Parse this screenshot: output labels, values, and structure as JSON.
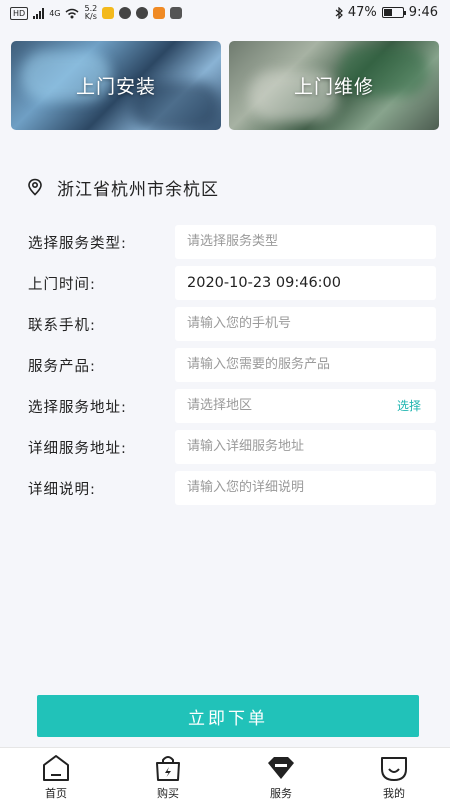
{
  "status_bar": {
    "hd": "HD",
    "net": "4G",
    "speed_value": "5.2",
    "speed_unit": "K/s",
    "battery": "47%",
    "time": "9:46",
    "battery_level": 0.47
  },
  "banners": [
    {
      "label": "上门安装",
      "icon": "install-photo"
    },
    {
      "label": "上门维修",
      "icon": "repair-photo"
    }
  ],
  "location": {
    "icon": "location-pin-icon",
    "text": "浙江省杭州市余杭区"
  },
  "form": {
    "service_type": {
      "label": "选择服务类型:",
      "placeholder": "请选择服务类型"
    },
    "visit_time": {
      "label": "上门时间:",
      "value": "2020-10-23 09:46:00"
    },
    "phone": {
      "label": "联系手机:",
      "placeholder": "请输入您的手机号"
    },
    "product": {
      "label": "服务产品:",
      "placeholder": "请输入您需要的服务产品"
    },
    "address": {
      "label": "选择服务地址:",
      "placeholder": "请选择地区",
      "action": "选择"
    },
    "address_detail": {
      "label": "详细服务地址:",
      "placeholder": "请输入详细服务地址"
    },
    "description": {
      "label": "详细说明:",
      "placeholder": "请输入您的详细说明"
    }
  },
  "submit": {
    "label": "立即下单"
  },
  "tabs": [
    {
      "label": "首页",
      "icon": "home-icon"
    },
    {
      "label": "购买",
      "icon": "shopping-bag-icon"
    },
    {
      "label": "服务",
      "icon": "diamond-icon",
      "active": true
    },
    {
      "label": "我的",
      "icon": "smile-icon"
    }
  ],
  "colors": {
    "accent": "#21c2b9",
    "background": "#f5f6fa",
    "text": "#222222",
    "placeholder": "#9a9a9a"
  }
}
